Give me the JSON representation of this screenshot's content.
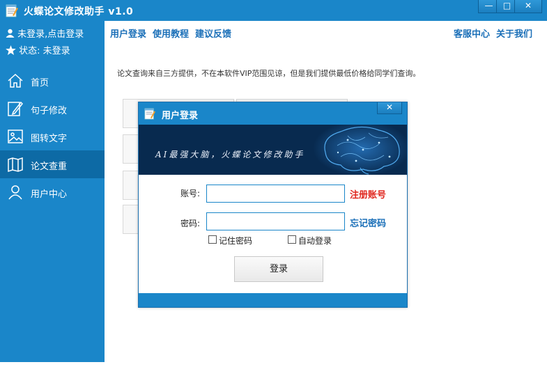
{
  "window": {
    "title": "火蝶论文修改助手 v1.0",
    "minimize_glyph": "—",
    "maximize_glyph": "□",
    "close_glyph": "✕"
  },
  "sidebar": {
    "user_status": "未登录,点击登录",
    "state_label": "状态:  未登录",
    "items": [
      {
        "label": "首页",
        "icon": "home-icon"
      },
      {
        "label": "句子修改",
        "icon": "edit-icon"
      },
      {
        "label": "图转文字",
        "icon": "image-icon"
      },
      {
        "label": "论文查重",
        "icon": "map-icon",
        "active": true
      },
      {
        "label": "用户中心",
        "icon": "user-icon"
      }
    ]
  },
  "top_links": {
    "left": [
      "用户登录",
      "使用教程",
      "建议反馈"
    ],
    "right": [
      "客服中心",
      "关于我们"
    ]
  },
  "main": {
    "notice": "论文查询来自三方提供，不在本软件VIP范围见谅，但是我们提供最低价格给同学们查询。"
  },
  "dialog": {
    "title": "用户登录",
    "close_glyph": "✕",
    "slogan": "AI最强大脑，火蝶论文修改助手",
    "account_label": "账号:",
    "account_value": "",
    "register_link": "注册账号",
    "password_label": "密码:",
    "password_value": "",
    "forgot_link": "忘记密码",
    "remember_label": "记住密码",
    "auto_login_label": "自动登录",
    "login_button": "登录"
  },
  "colors": {
    "primary": "#1a86c9",
    "active_nav": "#0d6aa5",
    "link_blue": "#1a6fb8",
    "link_red": "#e0271f",
    "banner_bg": "#082a4f"
  }
}
